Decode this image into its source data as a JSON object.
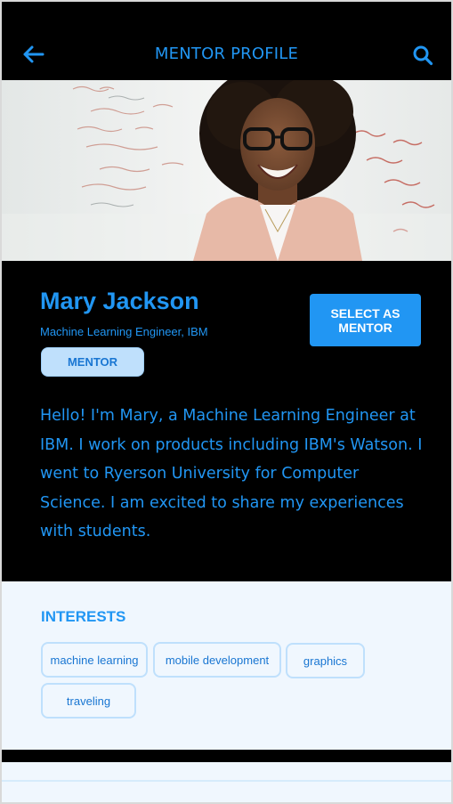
{
  "header": {
    "title": "MENTOR PROFILE",
    "back_icon": "arrow-left-icon",
    "search_icon": "search-icon"
  },
  "hero": {
    "description_icon": "mentor-photo"
  },
  "profile": {
    "name": "Mary Jackson",
    "subtitle": "Machine Learning Engineer, IBM",
    "role_badge": "MENTOR",
    "select_button": "SELECT AS MENTOR",
    "bio": "Hello! I'm Mary, a Machine Learning Engineer at IBM. I work on products including IBM's Watson. I went to Ryerson University for Computer Science. I am excited to share my experiences with students."
  },
  "interests": {
    "title": "INTERESTS",
    "items": [
      "machine learning",
      "mobile  development",
      "graphics",
      "traveling"
    ]
  },
  "colors": {
    "accent": "#2196f3",
    "chip_border": "#bfe0fc",
    "badge_bg": "#bfe0fc",
    "background_dark": "#000000",
    "background_light": "#f0f7fe"
  }
}
